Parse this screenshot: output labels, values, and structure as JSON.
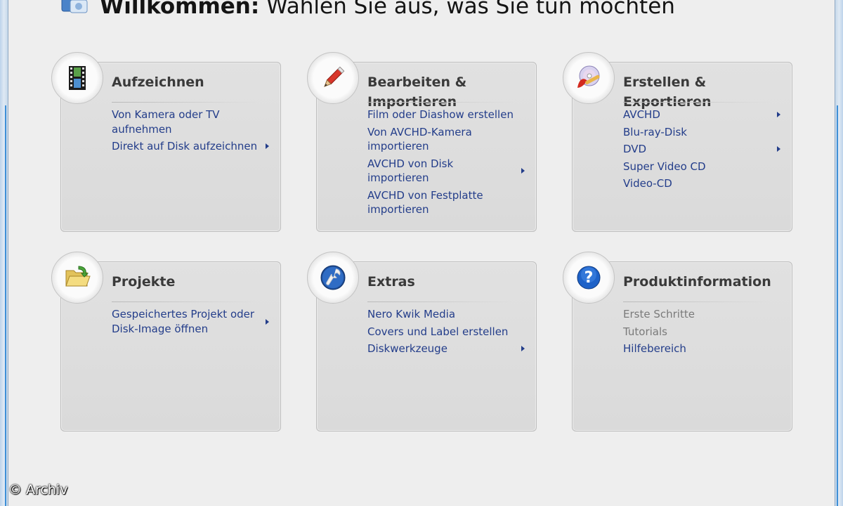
{
  "header": {
    "title_bold": "Willkommen:",
    "title_rest": " Wählen Sie aus, was Sie tun möchten"
  },
  "cards": [
    {
      "title": "Aufzeichnen",
      "icon": "film-icon",
      "items": [
        {
          "label": "Von Kamera oder TV aufnehmen",
          "submenu": false,
          "enabled": true
        },
        {
          "label": "Direkt auf Disk aufzeichnen",
          "submenu": true,
          "enabled": true
        }
      ]
    },
    {
      "title": "Bearbeiten & Importieren",
      "icon": "pencil-icon",
      "items": [
        {
          "label": "Film oder Diashow erstellen",
          "submenu": false,
          "enabled": true
        },
        {
          "label": "Von AVCHD-Kamera importieren",
          "submenu": false,
          "enabled": true
        },
        {
          "label": "AVCHD von Disk importieren",
          "submenu": true,
          "enabled": true
        },
        {
          "label": "AVCHD von Festplatte importieren",
          "submenu": false,
          "enabled": true
        }
      ]
    },
    {
      "title": "Erstellen & Exportieren",
      "icon": "disc-burn-icon",
      "items": [
        {
          "label": "AVCHD",
          "submenu": true,
          "enabled": true
        },
        {
          "label": "Blu-ray-Disk",
          "submenu": false,
          "enabled": true
        },
        {
          "label": "DVD",
          "submenu": true,
          "enabled": true
        },
        {
          "label": "Super Video CD",
          "submenu": false,
          "enabled": true
        },
        {
          "label": "Video-CD",
          "submenu": false,
          "enabled": true
        }
      ]
    },
    {
      "title": "Projekte",
      "icon": "folder-open-icon",
      "items": [
        {
          "label": "Gespeichertes Projekt oder Disk-Image öffnen",
          "submenu": true,
          "enabled": true
        }
      ]
    },
    {
      "title": "Extras",
      "icon": "wrench-icon",
      "items": [
        {
          "label": "Nero Kwik Media",
          "submenu": false,
          "enabled": true
        },
        {
          "label": "Covers und Label erstellen",
          "submenu": false,
          "enabled": true
        },
        {
          "label": "Diskwerkzeuge",
          "submenu": true,
          "enabled": true
        }
      ]
    },
    {
      "title": "Produktinformation",
      "icon": "help-icon",
      "items": [
        {
          "label": "Erste Schritte",
          "submenu": false,
          "enabled": false
        },
        {
          "label": "Tutorials",
          "submenu": false,
          "enabled": false
        },
        {
          "label": "Hilfebereich",
          "submenu": false,
          "enabled": true
        }
      ]
    }
  ],
  "watermark": "© Archiv",
  "colors": {
    "link": "#233d8a",
    "disabled": "#7a7a7a",
    "title": "#3a3a3a",
    "background": "#eeeeee"
  }
}
